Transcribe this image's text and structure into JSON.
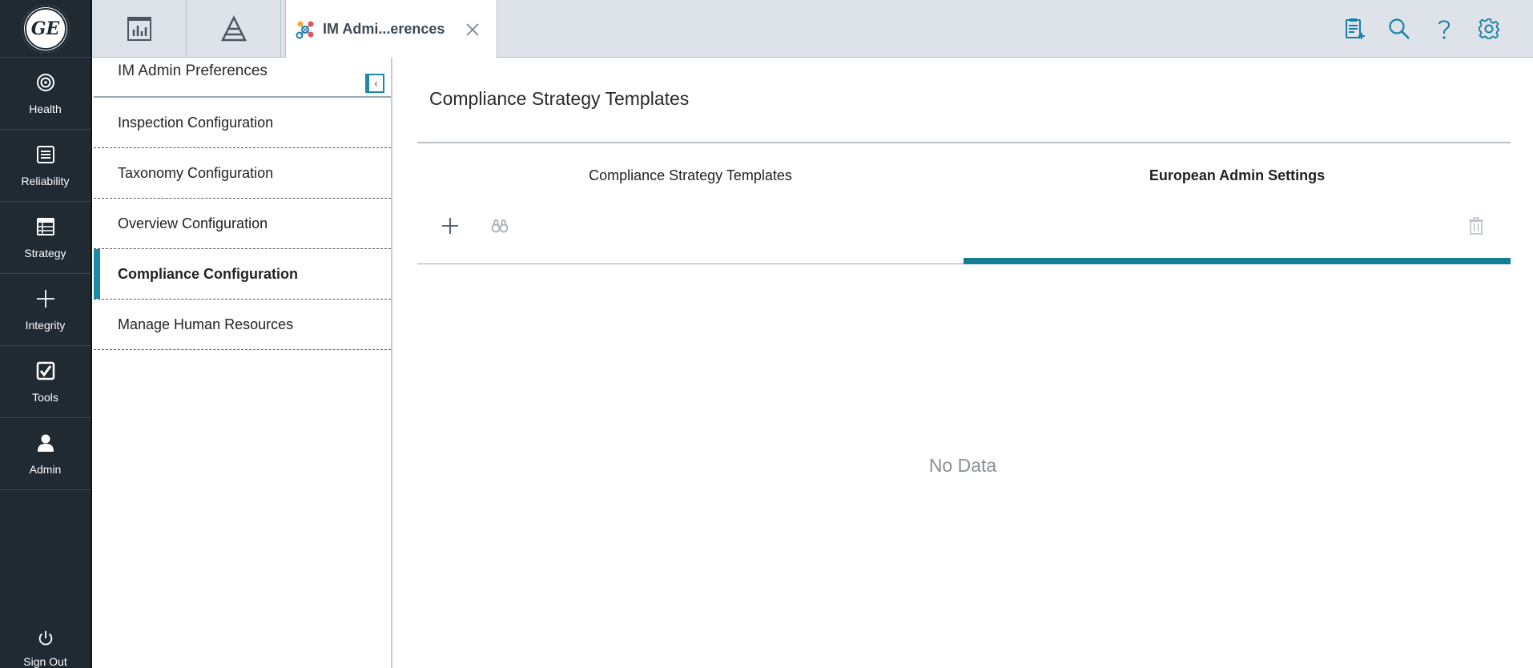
{
  "nav": {
    "logo_text": "GE",
    "items": [
      {
        "label": "Health",
        "icon": "target-icon"
      },
      {
        "label": "Reliability",
        "icon": "document-icon"
      },
      {
        "label": "Strategy",
        "icon": "table-icon"
      },
      {
        "label": "Integrity",
        "icon": "plus-icon"
      },
      {
        "label": "Tools",
        "icon": "checkbox-icon"
      },
      {
        "label": "Admin",
        "icon": "user-icon"
      }
    ],
    "signout_label": "Sign Out"
  },
  "tabs": {
    "active_title": "IM Admi...erences",
    "icon_tabs": [
      "dashboard-icon",
      "pyramid-icon"
    ]
  },
  "top_actions": [
    "clipboard-add-icon",
    "search-icon",
    "help-icon",
    "gear-icon"
  ],
  "preferences": {
    "title": "IM Admin Preferences",
    "items": [
      {
        "label": "Inspection Configuration",
        "active": false
      },
      {
        "label": "Taxonomy Configuration",
        "active": false
      },
      {
        "label": "Overview Configuration",
        "active": false
      },
      {
        "label": "Compliance Configuration",
        "active": true
      },
      {
        "label": "Manage Human Resources",
        "active": false
      }
    ]
  },
  "main": {
    "title": "Compliance Strategy Templates",
    "subtabs": [
      {
        "label": "Compliance Strategy Templates",
        "active": false
      },
      {
        "label": "European Admin Settings",
        "active": true
      }
    ],
    "empty_text": "No Data"
  },
  "colors": {
    "rail_bg": "#1f2a33",
    "accent": "#137d95",
    "topbar_bg": "#dde3e8",
    "icon_blue": "#1a7fa8"
  }
}
